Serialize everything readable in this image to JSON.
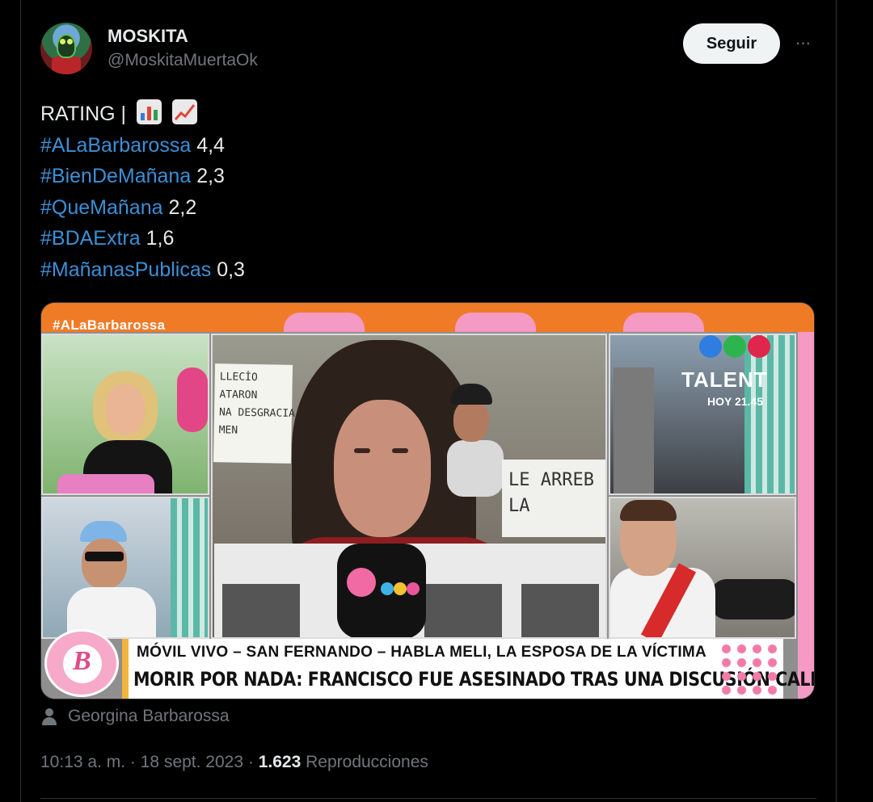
{
  "author": {
    "display_name": "MOSKITA",
    "handle": "@MoskitaMuertaOk"
  },
  "actions": {
    "follow_label": "Seguir",
    "more_label": "···"
  },
  "tweet": {
    "heading": "RATING |",
    "heading_icons": [
      "bar-chart-emoji",
      "chart-increasing-emoji"
    ],
    "ratings": [
      {
        "hashtag": "#ALaBarbarossa",
        "value": "4,4"
      },
      {
        "hashtag": "#BienDeMañana",
        "value": "2,3"
      },
      {
        "hashtag": "#QueMañana",
        "value": "2,2"
      },
      {
        "hashtag": "#BDAExtra",
        "value": "1,6"
      },
      {
        "hashtag": "#MañanasPublicas",
        "value": "0,3"
      }
    ]
  },
  "media": {
    "overlay_hashtag": "#ALaBarbarossa",
    "sign_left_text": "LLECİO\nATARON\nNA DESGRACIA\nMEN",
    "sign_right_text": "LE ARREB\nLA",
    "promo_title": "TALENT",
    "promo_time": "HOY 21.45",
    "lower_third_line1": "MÓVIL VIVO – SAN FERNANDO – HABLA MELI, LA ESPOSA DE LA VÍCTIMA",
    "lower_third_line2": "MORIR POR NADA: FRANCISCO FUE ASESINADO TRAS UNA DISCUSIÓN CALLEJERA",
    "badge_letter": "B",
    "colors": {
      "orange": "#f07b27",
      "pink": "#f49ac4",
      "teal_stripe": "#5bb8a6",
      "lower_third_accent": "#f2b43a"
    },
    "credit_name": "Georgina Barbarossa"
  },
  "meta": {
    "time": "10:13 a. m.",
    "date": "18 sept. 2023",
    "views_count": "1.623",
    "views_label": "Reproducciones",
    "separator": "·"
  },
  "colors": {
    "background": "#000000",
    "hashtag": "#3b8fd6",
    "secondary_text": "#71767b",
    "primary_text": "#e7e9ea",
    "follow_button_bg": "#eff3f4"
  }
}
